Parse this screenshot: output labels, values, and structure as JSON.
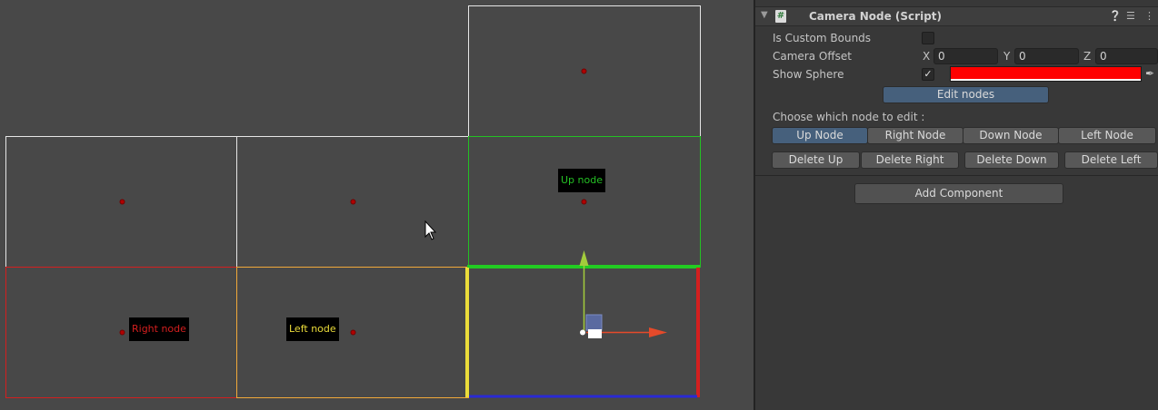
{
  "scene": {
    "labels": {
      "up": "Up node",
      "right": "Right node",
      "left": "Left node"
    },
    "colors": {
      "up": "#24c124",
      "right": "#d41f1f",
      "left": "#ebdc3a",
      "center_point": "#b00000",
      "gizmo_x": "#e54a2a",
      "gizmo_y": "#a3cc3c",
      "gizmo_handle": "#5a6aa0"
    }
  },
  "inspector": {
    "component": {
      "title": "Camera Node (Script)",
      "script_icon": "#",
      "icons": [
        "help-icon",
        "preset-icon",
        "more-icon"
      ]
    },
    "fields": {
      "is_custom_bounds": {
        "label": "Is Custom Bounds",
        "checked": false
      },
      "camera_offset": {
        "label": "Camera Offset",
        "x_label": "X",
        "x": "0",
        "y_label": "Y",
        "y": "0",
        "z_label": "Z",
        "z": "0"
      },
      "show_sphere": {
        "label": "Show Sphere",
        "checked": true,
        "color": "#ff0000"
      }
    },
    "edit_nodes_button": "Edit nodes",
    "choose_label": "Choose which node to edit :",
    "node_tabs": [
      "Up Node",
      "Right Node",
      "Down Node",
      "Left Node"
    ],
    "active_tab": "Up Node",
    "delete_buttons": [
      "Delete Up",
      "Delete Right",
      "Delete Down",
      "Delete Left"
    ],
    "add_component_button": "Add Component"
  }
}
